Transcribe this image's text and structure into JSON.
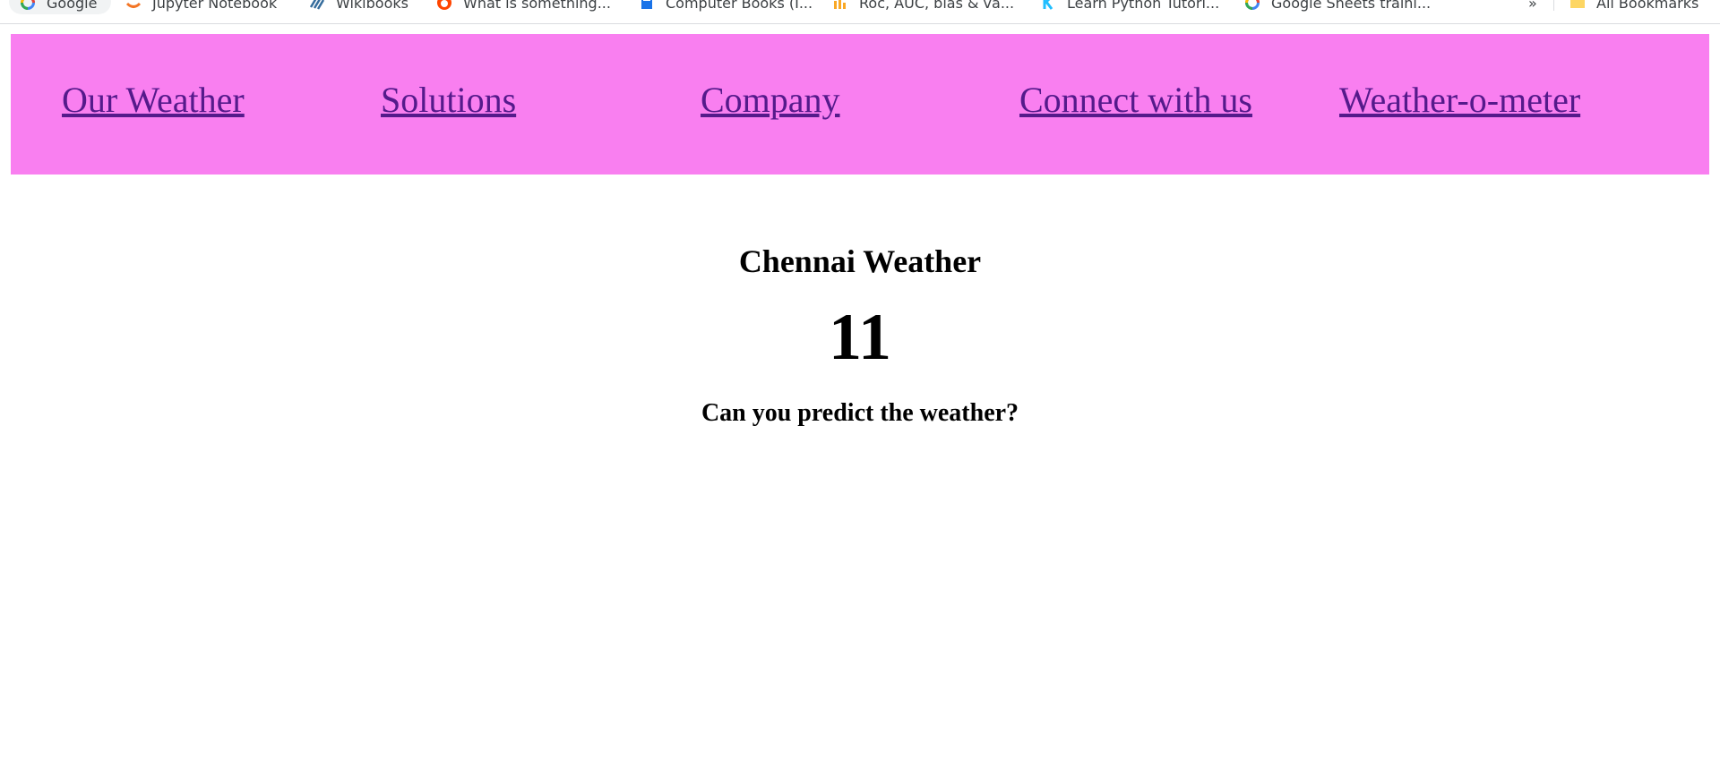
{
  "bookmarks": {
    "items": [
      {
        "label": "Google",
        "icon": "google-icon"
      },
      {
        "label": "Jupyter Notebook",
        "icon": "jupyter-icon"
      },
      {
        "label": "Wikibooks",
        "icon": "wikibooks-icon"
      },
      {
        "label": "What is something...",
        "icon": "reddit-icon"
      },
      {
        "label": "Computer Books (I...",
        "icon": "book-icon"
      },
      {
        "label": "Roc, AUC, bias & va...",
        "icon": "chart-icon"
      },
      {
        "label": "Learn Python Tutori...",
        "icon": "kaggle-icon"
      },
      {
        "label": "Google Sheets traini...",
        "icon": "google-icon"
      }
    ],
    "overflow": "»",
    "all_bookmarks": "All Bookmarks"
  },
  "nav": {
    "background": "#f97ff0",
    "link_color": "#551a8b",
    "links": [
      {
        "label": "Our Weather"
      },
      {
        "label": "Solutions"
      },
      {
        "label": "Company"
      },
      {
        "label": "Connect with us"
      },
      {
        "label": "Weather-o-meter"
      }
    ]
  },
  "main": {
    "title": "Chennai Weather",
    "value": "11",
    "question": "Can you predict the weather?"
  }
}
